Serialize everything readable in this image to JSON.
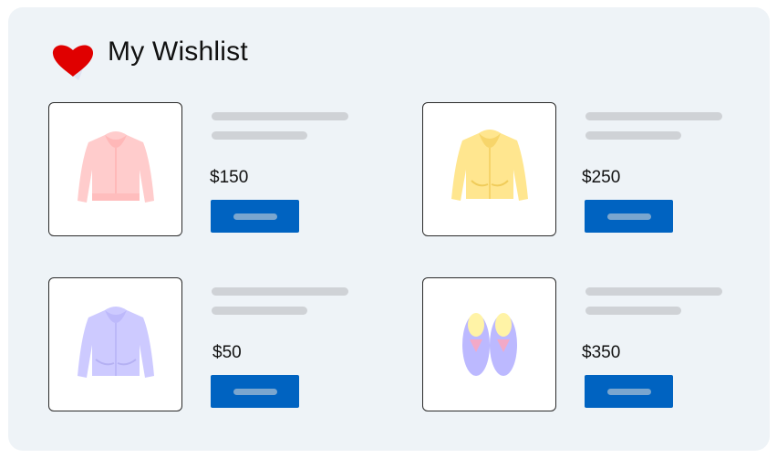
{
  "header": {
    "title": "My Wishlist",
    "icon": "heart-icon"
  },
  "colors": {
    "panel": "#eef3f7",
    "heart": "#e00000",
    "button": "#0063c1",
    "placeholder": "#cfd2d6"
  },
  "items": [
    {
      "product": "jacket",
      "image_icon": "pink-jacket-icon",
      "color": "#ffc9c9",
      "price": "$150"
    },
    {
      "product": "jacket",
      "image_icon": "yellow-jacket-icon",
      "color": "#ffe48a",
      "price": "$250"
    },
    {
      "product": "jacket",
      "image_icon": "lavender-jacket-icon",
      "color": "#c9c6ff",
      "price": "$50"
    },
    {
      "product": "shoes",
      "image_icon": "sneakers-icon",
      "color": "#b9b6ff",
      "price": "$350"
    }
  ]
}
